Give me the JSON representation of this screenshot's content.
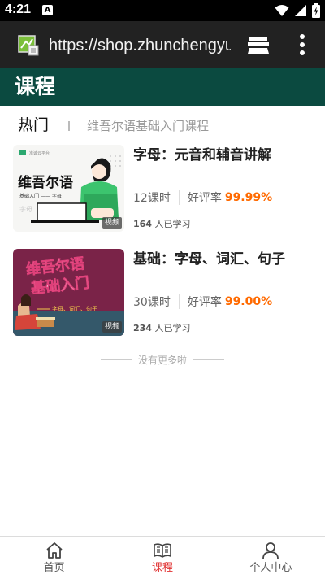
{
  "status_bar": {
    "time": "4:21",
    "notification_badge": "A",
    "icons": [
      "wifi-icon",
      "signal-icon",
      "battery-icon"
    ]
  },
  "browser": {
    "url": "https://shop.zhunchengyun",
    "icons": [
      "site-icon",
      "tabs-icon",
      "more-vert-icon"
    ]
  },
  "header": {
    "title": "课程"
  },
  "category_tabs": [
    {
      "label": "热门",
      "active": true
    },
    {
      "label": "维吾尔语基础入门课程",
      "active": false
    }
  ],
  "courses": [
    {
      "title": "字母：元音和辅音讲解",
      "lessons": "12课时",
      "rating_label": "好评率",
      "rating_value": "99.99%",
      "learners_count": "164",
      "learners_suffix": "人已学习",
      "badge": "视频",
      "thumb_title": "维吾尔语",
      "thumb_sub": "基础入门 —— 字母",
      "thumb_logo": "准诚云平台",
      "thumb_deco": "字母"
    },
    {
      "title": "基础：字母、词汇、句子",
      "lessons": "30课时",
      "rating_label": "好评率",
      "rating_value": "99.00%",
      "learners_count": "234",
      "learners_suffix": "人已学习",
      "badge": "视频",
      "thumb_title_line1": "维吾尔语",
      "thumb_title_line2": "基础入门",
      "thumb_sub": "字母、词汇、句子"
    }
  ],
  "list_end": "没有更多啦",
  "bottom_nav": [
    {
      "label": "首页",
      "icon": "home-icon",
      "active": false
    },
    {
      "label": "课程",
      "icon": "book-icon",
      "active": true
    },
    {
      "label": "个人中心",
      "icon": "person-icon",
      "active": false
    }
  ],
  "colors": {
    "header_bg": "#0b4a40",
    "rating": "#ff6a00",
    "nav_active": "#e03030",
    "browser_bg": "#222222"
  }
}
